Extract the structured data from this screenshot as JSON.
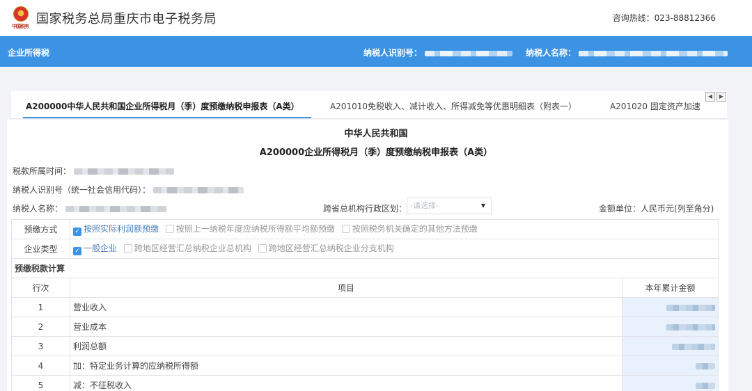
{
  "header": {
    "site_title": "国家税务总局重庆市电子税务局",
    "hotline": "咨询热线：023-88812366"
  },
  "bluebar": {
    "tax_name": "企业所得税",
    "taxpayer_id_label": "纳税人识别号：",
    "taxpayer_name_label": "纳税人名称："
  },
  "tabs": [
    {
      "label": "A200000中华人民共和国企业所得税月（季）度预缴纳税申报表（A类）",
      "active": true
    },
    {
      "label": "A201010免税收入、减计收入、所得减免等优惠明细表（附表一）",
      "active": false
    },
    {
      "label": "A201020 固定资产加速折",
      "active": false
    }
  ],
  "form": {
    "title_line1": "中华人民共和国",
    "title_line2": "A200000企业所得税月（季）度预缴纳税申报表（A类）",
    "period_label": "税款所属时间：",
    "credit_code_label": "纳税人识别号（统一社会信用代码）：",
    "name_label": "纳税人名称：",
    "region_label": "跨省总机构行政区划：",
    "region_placeholder": "-请选择-",
    "unit_label": "金额单位：人民币元(列至角分)"
  },
  "prepay_method": {
    "label": "预缴方式",
    "options": [
      {
        "text": "按照实际利润额预缴",
        "checked": true
      },
      {
        "text": "按照上一纳税年度应纳税所得额平均额预缴",
        "checked": false
      },
      {
        "text": "按照税务机关确定的其他方法预缴",
        "checked": false
      }
    ]
  },
  "enterprise_type": {
    "label": "企业类型",
    "options": [
      {
        "text": "一般企业",
        "checked": true
      },
      {
        "text": "跨地区经营汇总纳税企业总机构",
        "checked": false
      },
      {
        "text": "跨地区经营汇总纳税企业分支机构",
        "checked": false
      }
    ]
  },
  "calc_section": {
    "title": "预缴税款计算",
    "col_row": "行次",
    "col_item": "项目",
    "col_amount": "本年累计金额",
    "rows": [
      {
        "no": "1",
        "item": "营业收入"
      },
      {
        "no": "2",
        "item": "营业成本"
      },
      {
        "no": "3",
        "item": "利润总额"
      },
      {
        "no": "4",
        "item": "加：特定业务计算的应纳税所得额"
      },
      {
        "no": "5",
        "item": "减：不征税收入"
      }
    ]
  },
  "colors": {
    "accent": "#3c93e4",
    "amount_cell_bg": "#e9f2fc",
    "page_bg": "#f1f3f6"
  }
}
